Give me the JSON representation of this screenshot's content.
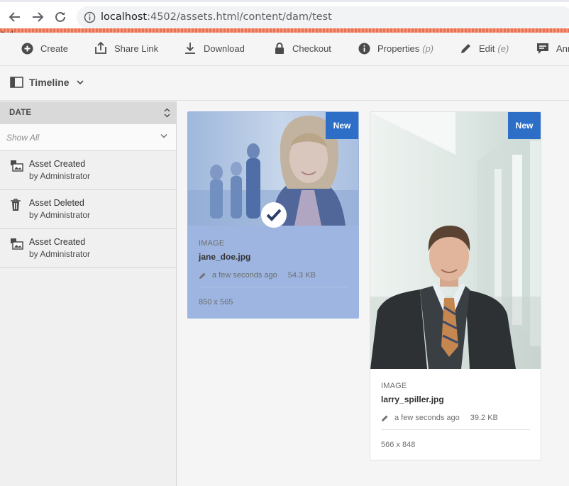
{
  "browser": {
    "url_host": "localhost",
    "url_rest": ":4502/assets.html/content/dam/test"
  },
  "environment": {
    "label": "Author"
  },
  "toolbar": {
    "create": "Create",
    "share_link": "Share Link",
    "download": "Download",
    "checkout": "Checkout",
    "properties": "Properties",
    "properties_shortcut": "(p)",
    "edit": "Edit",
    "edit_shortcut": "(e)",
    "annotate": "Annotate"
  },
  "rail": {
    "title": "Timeline",
    "filter_heading": "DATE",
    "filter_value": "Show All",
    "items": [
      {
        "event": "Asset Created",
        "by": "by Administrator",
        "icon": "asset-created-icon"
      },
      {
        "event": "Asset Deleted",
        "by": "by Administrator",
        "icon": "trash-icon"
      },
      {
        "event": "Asset Created",
        "by": "by Administrator",
        "icon": "asset-created-icon"
      }
    ]
  },
  "cards": [
    {
      "badge": "New",
      "type": "IMAGE",
      "name": "jane_doe.jpg",
      "modified": "a few seconds ago",
      "size": "54.3 KB",
      "dimensions": "850 x 565",
      "selected": true
    },
    {
      "badge": "New",
      "type": "IMAGE",
      "name": "larry_spiller.jpg",
      "modified": "a few seconds ago",
      "size": "39.2 KB",
      "dimensions": "566 x 848",
      "selected": false
    }
  ],
  "colors": {
    "accent": "#2d6fc7",
    "selection": "#9db5e0",
    "author_strip": "#eb7153"
  }
}
